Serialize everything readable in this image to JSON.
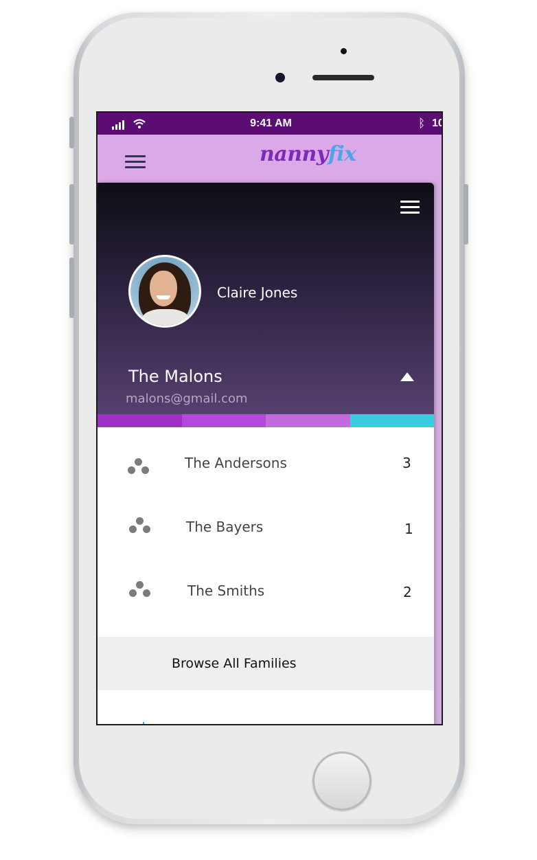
{
  "status_bar": {
    "time": "9:41 AM",
    "battery": "10"
  },
  "app": {
    "logo_part1": "nanny",
    "logo_part2": "fix"
  },
  "drawer": {
    "user_name": "Claire Jones",
    "current_family": "The Malons",
    "email": "malons@gmail.com",
    "color_bar": [
      "#a12fc6",
      "#b447dc",
      "#c46ae0",
      "#3acde0"
    ],
    "families": [
      {
        "name": "The Andersons",
        "count": "3"
      },
      {
        "name": "The Bayers",
        "count": "1"
      },
      {
        "name": "The Smiths",
        "count": "2"
      }
    ],
    "browse_label": "Browse All Families"
  },
  "icons": [
    "signal-icon",
    "wifi-icon",
    "bluetooth-icon",
    "menu-icon",
    "caret-up-icon",
    "family-group-icon"
  ]
}
